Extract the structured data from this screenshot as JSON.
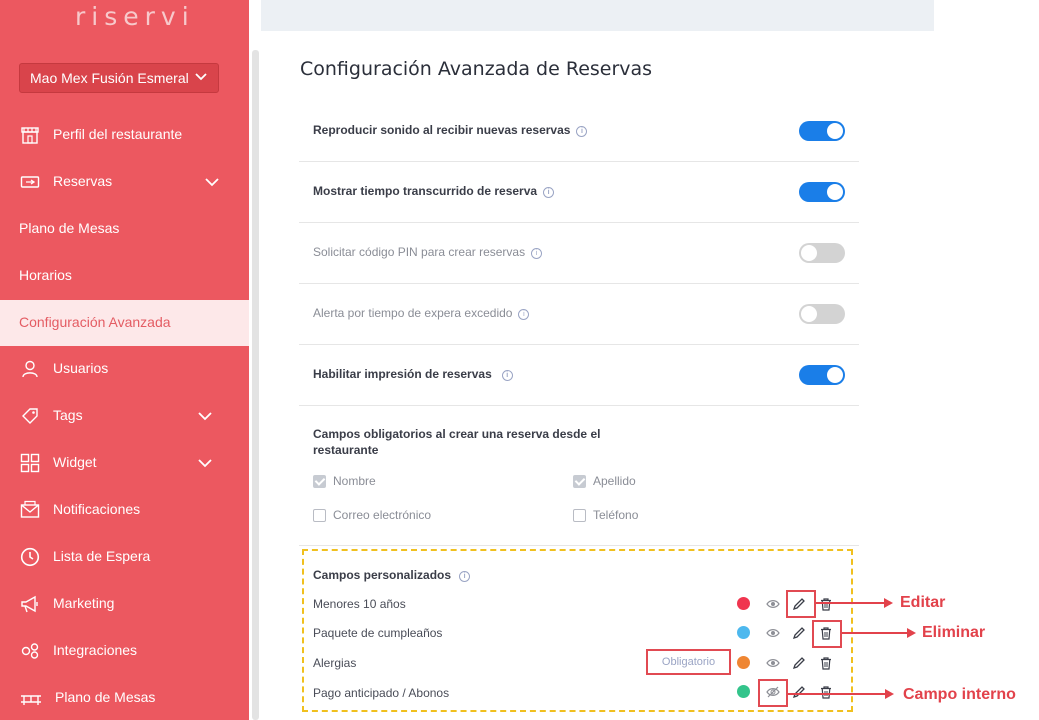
{
  "app": {
    "logo": "riservi"
  },
  "venue_selector": {
    "value": "Mao Mex Fusión Esmeral"
  },
  "sidebar": {
    "items": [
      {
        "label": "Perfil del restaurante",
        "icon": "storefront-icon"
      },
      {
        "label": "Reservas",
        "icon": "ticket-icon",
        "expandable": true
      },
      {
        "label": "Plano de Mesas"
      },
      {
        "label": "Horarios"
      },
      {
        "label": "Configuración Avanzada",
        "active": true
      },
      {
        "label": "Usuarios",
        "icon": "user-icon"
      },
      {
        "label": "Tags",
        "icon": "tag-icon",
        "expandable": true
      },
      {
        "label": "Widget",
        "icon": "widget-grid-icon",
        "expandable": true
      },
      {
        "label": "Notificaciones",
        "icon": "envelope-icon"
      },
      {
        "label": "Lista de Espera",
        "icon": "clock-icon"
      },
      {
        "label": "Marketing",
        "icon": "megaphone-icon"
      },
      {
        "label": "Integraciones",
        "icon": "integrations-icon"
      },
      {
        "label": "Plano de Mesas",
        "icon": "tables-map-icon"
      }
    ]
  },
  "main": {
    "title": "Configuración Avanzada de Reservas",
    "settings": [
      {
        "label": "Reproducir sonido al recibir nuevas reservas",
        "enabled": true
      },
      {
        "label": "Mostrar tiempo transcurrido de reserva",
        "enabled": true
      },
      {
        "label": "Solicitar código PIN para crear reservas",
        "enabled": false
      },
      {
        "label": "Alerta por tiempo de expera excedido",
        "enabled": false
      },
      {
        "label": "Habilitar impresión de reservas",
        "enabled": true
      }
    ],
    "mandatory_fields": {
      "title": "Campos obligatorios al crear una reserva desde el restaurante",
      "options": [
        {
          "label": "Nombre",
          "checked": true
        },
        {
          "label": "Apellido",
          "checked": true
        },
        {
          "label": "Correo electrónico",
          "checked": false
        },
        {
          "label": "Teléfono",
          "checked": false
        }
      ]
    },
    "custom_fields": {
      "title": "Campos personalizados",
      "items": [
        {
          "label": "Menores 10 años",
          "color": "#f0354f",
          "visible": true
        },
        {
          "label": "Paquete de cumpleaños",
          "color": "#4db8ee",
          "visible": true
        },
        {
          "label": "Alergias",
          "color": "#ef8633",
          "visible": true,
          "tag": "Obligatorio"
        },
        {
          "label": "Pago anticipado / Abonos",
          "color": "#33c48b",
          "visible": false
        }
      ]
    }
  },
  "annotations": {
    "edit": "Editar",
    "delete": "Eliminar",
    "internal": "Campo interno"
  },
  "colors": {
    "sidebar": "#ec5860",
    "toggle_on": "#1a7ee8",
    "toggle_off": "#d3d3d3",
    "annotation": "#e2424b",
    "dashed_border": "#f0c01f"
  }
}
